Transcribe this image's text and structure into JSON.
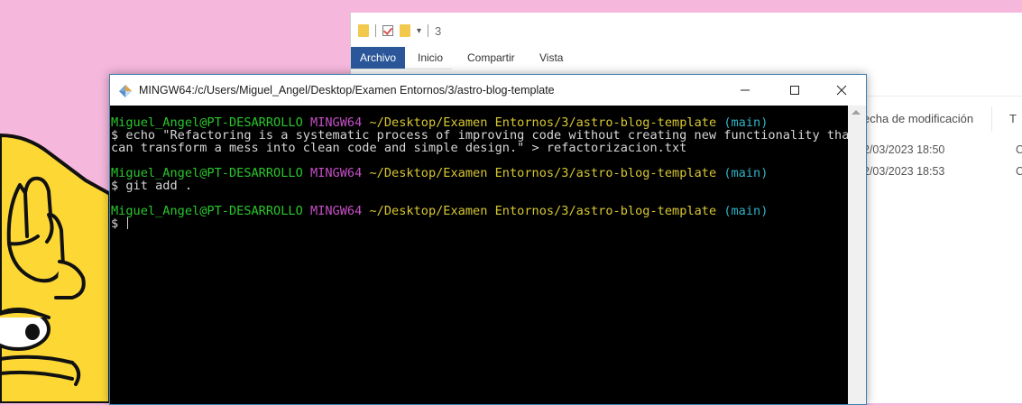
{
  "explorer": {
    "qat_counter": "3",
    "ribbon_tabs": [
      {
        "label": "Archivo",
        "active": true
      },
      {
        "label": "Inicio",
        "active": false
      },
      {
        "label": "Compartir",
        "active": false
      },
      {
        "label": "Vista",
        "active": false
      }
    ],
    "columns": {
      "modified": "echa de modificación",
      "type": "T"
    },
    "rows": [
      {
        "modified": "2/03/2023 18:50",
        "type": "C"
      },
      {
        "modified": "2/03/2023 18:53",
        "type": "C"
      }
    ]
  },
  "terminal": {
    "title": "MINGW64:/c/Users/Miguel_Angel/Desktop/Examen Entornos/3/astro-blog-template",
    "prompt": {
      "user_host": "Miguel_Angel@PT-DESARROLLO",
      "system": "MINGW64",
      "path": "~/Desktop/Examen Entornos/3/astro-blog-template",
      "branch": "(main)"
    },
    "commands": {
      "first_line1": "$ echo \"Refactoring is a systematic process of improving code without creating new functionality that",
      "first_line2": "can transform a mess into clean code and simple design.\" > refactorizacion.txt",
      "second": "$ git add .",
      "third": "$ "
    },
    "buttons": {
      "minimize": "—",
      "maximize": "☐",
      "close": "✕"
    }
  },
  "colors": {
    "wallpaper": "#f5b7dc",
    "ribbon_active": "#2b579a",
    "prompt_user": "#29c62c",
    "prompt_system": "#c64fc6",
    "prompt_path": "#d7c733",
    "prompt_branch": "#2fb3c6"
  }
}
